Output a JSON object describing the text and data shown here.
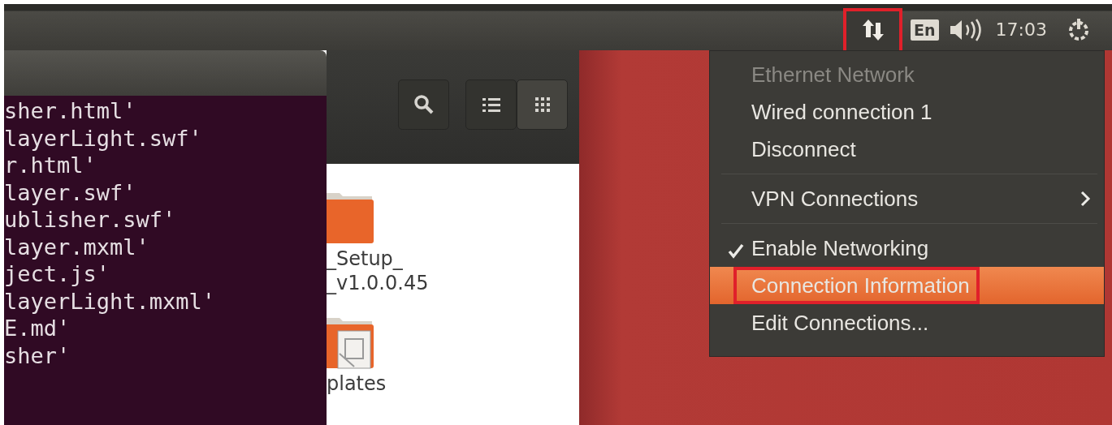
{
  "top_panel": {
    "network_indicator": {
      "annotated": true
    },
    "keyboard_layout": "En",
    "clock": "17:03"
  },
  "terminal": {
    "lines": [
      "sher.html'",
      "layerLight.swf'",
      "r.html'",
      "layer.swf'",
      "ublisher.swf'",
      "layer.mxml'",
      "ject.js'",
      "layerLight.mxml'",
      "E.md'",
      "sher'"
    ]
  },
  "file_manager": {
    "view_buttons": [
      {
        "kind": "list",
        "selected": false
      },
      {
        "kind": "grid",
        "selected": true
      }
    ],
    "files": [
      {
        "kind": "folder",
        "name_lines": [
          "_Setup_",
          "_v1.0.0.45"
        ]
      },
      {
        "kind": "templates",
        "name_lines": [
          "plates"
        ]
      }
    ]
  },
  "network_menu": {
    "items": [
      {
        "kind": "header",
        "label": "Ethernet Network",
        "disabled": true
      },
      {
        "kind": "item",
        "label": "Wired connection 1",
        "selected": false,
        "annotated": false
      },
      {
        "kind": "item",
        "label": "Disconnect",
        "selected": false,
        "annotated": false
      },
      {
        "kind": "separator"
      },
      {
        "kind": "submenu",
        "label": "VPN Connections",
        "selected": false
      },
      {
        "kind": "separator"
      },
      {
        "kind": "check",
        "label": "Enable Networking",
        "checked": true,
        "selected": false
      },
      {
        "kind": "item",
        "label": "Connection Information",
        "selected": true,
        "annotated": true
      },
      {
        "kind": "item",
        "label": "Edit Connections...",
        "selected": false,
        "annotated": false
      }
    ]
  }
}
